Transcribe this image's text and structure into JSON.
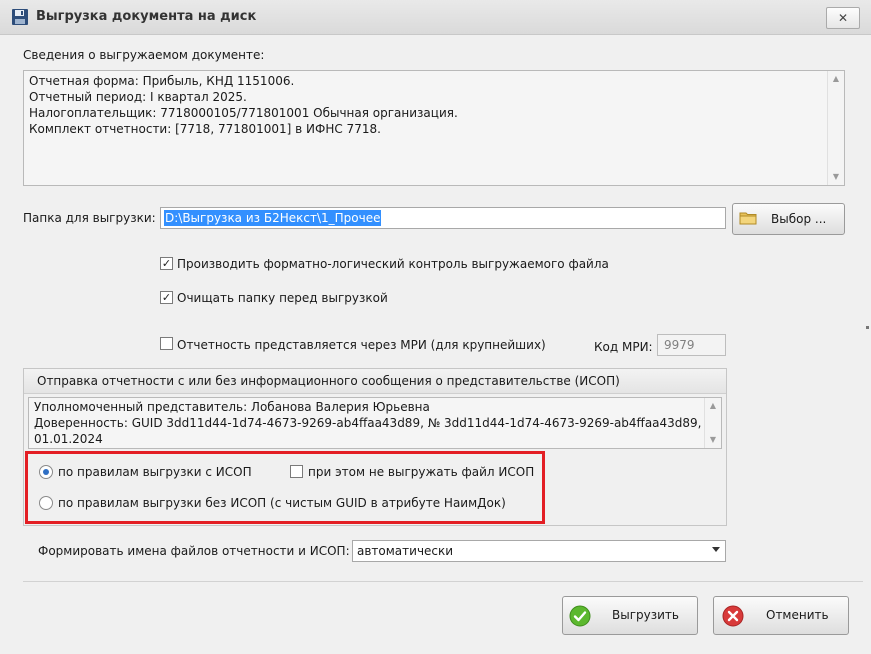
{
  "window": {
    "title": "Выгрузка документа на диск",
    "close_label": "✕"
  },
  "document_info": {
    "label": "Сведения о выгружаемом документе:",
    "lines": [
      "Отчетная форма: Прибыль, КНД 1151006.",
      "Отчетный период: I квартал 2025.",
      "Налогоплательщик: 7718000105/771801001 Обычная организация.",
      "Комплект отчетности: [7718, 771801001] в ИФНС 7718."
    ]
  },
  "export_folder": {
    "label": "Папка для выгрузки:",
    "value": "D:\\Выгрузка из Б2Некст\\1_Прочее",
    "browse_label": "Выбор ..."
  },
  "options": {
    "flk_check": {
      "label": "Производить форматно-логический контроль выгружаемого файла",
      "checked": true
    },
    "clear_folder": {
      "label": "Очищать папку перед выгрузкой",
      "checked": true
    },
    "mri": {
      "label": "Отчетность представляется через МРИ (для крупнейших)",
      "checked": false
    },
    "mri_code_label": "Код МРИ:",
    "mri_code_value": "9979"
  },
  "isop_group": {
    "title": "Отправка отчетности с или без информационного сообщения о представительстве (ИСОП)",
    "lines": [
      "Уполномоченный представитель: Лобанова Валерия Юрьевна",
      "Доверенность: GUID 3dd11d44-1d74-4673-9269-ab4ffaa43d89, № 3dd11d44-1d74-4673-9269-ab4ffaa43d89,  от",
      "01.01.2024"
    ],
    "radio_with_isop": {
      "label": "по правилам выгрузки с ИСОП",
      "selected": true
    },
    "no_export_isop_file": {
      "label": "при этом не выгружать файл ИСОП",
      "checked": false
    },
    "radio_without_isop": {
      "label": "по правилам выгрузки без ИСОП (с чистым GUID в атрибуте НаимДок)",
      "selected": false
    }
  },
  "file_names": {
    "label": "Формировать имена файлов отчетности и ИСОП:",
    "value": "автоматически"
  },
  "buttons": {
    "export_label": "Выгрузить",
    "cancel_label": "Отменить"
  },
  "colors": {
    "highlight_frame": "#e31e24",
    "selection": "#3390ff",
    "ok_icon": "#5cb82e",
    "cancel_icon": "#d83a3a"
  }
}
